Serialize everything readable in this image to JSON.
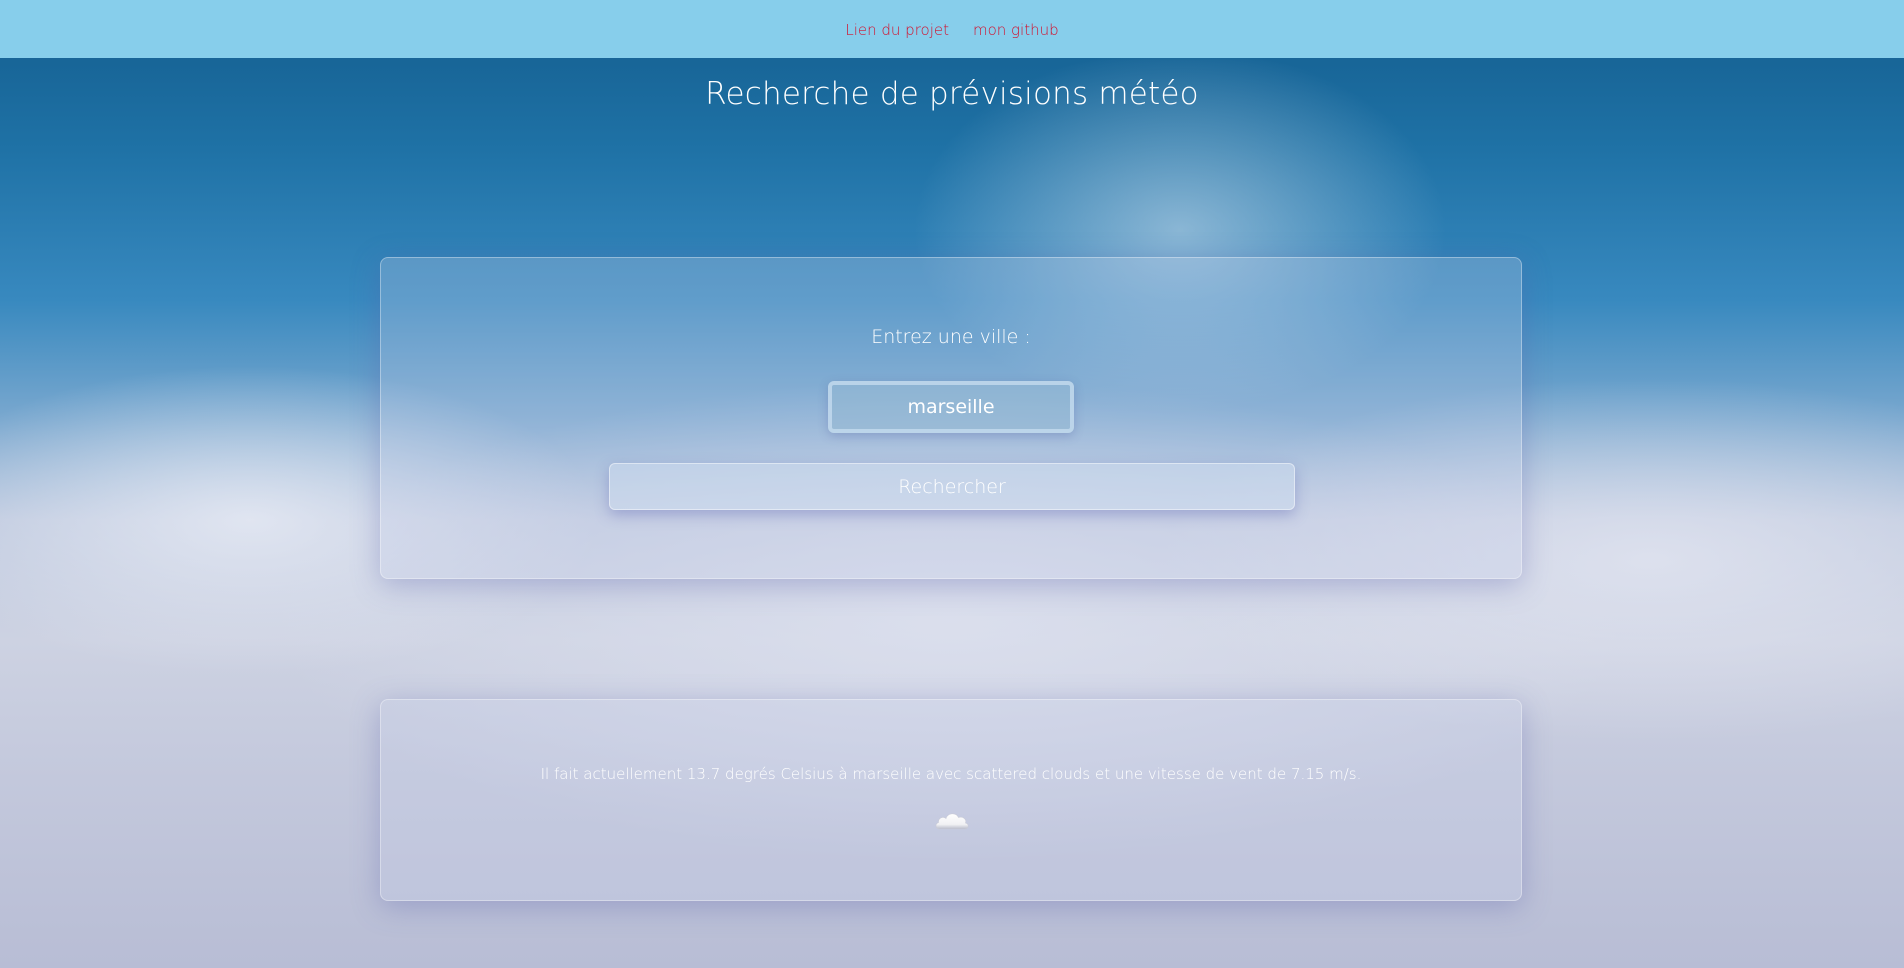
{
  "nav": {
    "links": [
      {
        "label": "Lien du projet"
      },
      {
        "label": "mon github"
      }
    ],
    "link_color": "#d2122e",
    "background": "#87ceeb"
  },
  "page": {
    "title": "Recherche de prévisions météo"
  },
  "search": {
    "label": "Entrez une ville :",
    "input_value": "marseille",
    "button_label": "Rechercher"
  },
  "result": {
    "text": "Il fait actuellement 13.7 degrés Celsius à marseille avec scattered clouds et une vitesse de vent de 7.15 m/s.",
    "icon": "cloud-icon"
  }
}
